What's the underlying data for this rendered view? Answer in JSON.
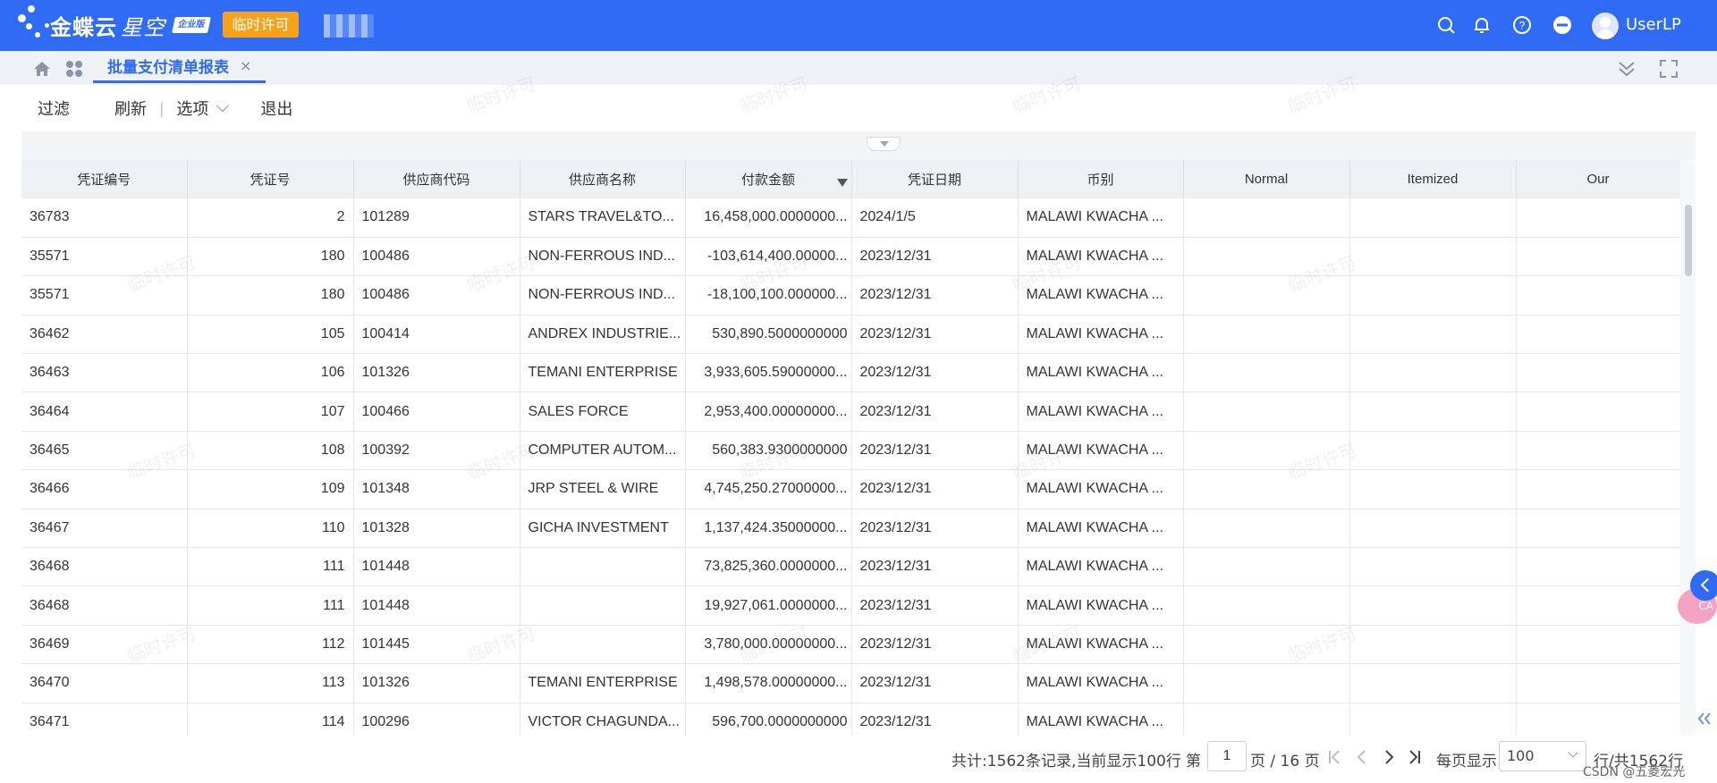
{
  "header": {
    "brand_main": "金蝶云",
    "brand_sub": "星空",
    "edition_badge": "企业版",
    "license_button": "临时许可",
    "user_name": "UserLP",
    "colors": {
      "bar": "#2f6bf5",
      "license": "#f7a21b"
    }
  },
  "tabs": [
    {
      "label": "批量支付清单报表",
      "close": "×",
      "active": true
    }
  ],
  "toolbar": {
    "filter": "过滤",
    "refresh": "刷新",
    "separator": "|",
    "options": "选项",
    "exit": "退出"
  },
  "table": {
    "columns": [
      "凭证编号",
      "凭证号",
      "供应商代码",
      "供应商名称",
      "付款金额",
      "凭证日期",
      "币别",
      "Normal",
      "Itemized",
      "Our"
    ],
    "rows": [
      [
        "36783",
        "2",
        "101289",
        "STARS TRAVEL&TO...",
        "16,458,000.0000000...",
        "2024/1/5",
        "MALAWI KWACHA ...",
        "",
        "",
        ""
      ],
      [
        "35571",
        "180",
        "100486",
        "NON-FERROUS IND...",
        "-103,614,400.00000...",
        "2023/12/31",
        "MALAWI KWACHA ...",
        "",
        "",
        ""
      ],
      [
        "35571",
        "180",
        "100486",
        "NON-FERROUS IND...",
        "-18,100,100.000000...",
        "2023/12/31",
        "MALAWI KWACHA ...",
        "",
        "",
        ""
      ],
      [
        "36462",
        "105",
        "100414",
        "ANDREX INDUSTRIE...",
        "530,890.5000000000",
        "2023/12/31",
        "MALAWI KWACHA ...",
        "",
        "",
        ""
      ],
      [
        "36463",
        "106",
        "101326",
        "TEMANI ENTERPRISE",
        "3,933,605.59000000...",
        "2023/12/31",
        "MALAWI KWACHA ...",
        "",
        "",
        ""
      ],
      [
        "36464",
        "107",
        "100466",
        "SALES FORCE",
        "2,953,400.00000000...",
        "2023/12/31",
        "MALAWI KWACHA ...",
        "",
        "",
        ""
      ],
      [
        "36465",
        "108",
        "100392",
        "COMPUTER AUTOM...",
        "560,383.9300000000",
        "2023/12/31",
        "MALAWI KWACHA ...",
        "",
        "",
        ""
      ],
      [
        "36466",
        "109",
        "101348",
        "JRP STEEL & WIRE",
        "4,745,250.27000000...",
        "2023/12/31",
        "MALAWI KWACHA ...",
        "",
        "",
        ""
      ],
      [
        "36467",
        "110",
        "101328",
        "GICHA INVESTMENT",
        "1,137,424.35000000...",
        "2023/12/31",
        "MALAWI KWACHA ...",
        "",
        "",
        ""
      ],
      [
        "36468",
        "111",
        "101448",
        "",
        "73,825,360.0000000...",
        "2023/12/31",
        "MALAWI KWACHA ...",
        "",
        "",
        ""
      ],
      [
        "36468",
        "111",
        "101448",
        "",
        "19,927,061.0000000...",
        "2023/12/31",
        "MALAWI KWACHA ...",
        "",
        "",
        ""
      ],
      [
        "36469",
        "112",
        "101445",
        "",
        "3,780,000.00000000...",
        "2023/12/31",
        "MALAWI KWACHA ...",
        "",
        "",
        ""
      ],
      [
        "36470",
        "113",
        "101326",
        "TEMANI ENTERPRISE",
        "1,498,578.00000000...",
        "2023/12/31",
        "MALAWI KWACHA ...",
        "",
        "",
        ""
      ],
      [
        "36471",
        "114",
        "100296",
        "VICTOR CHAGUNDA...",
        "596,700.0000000000",
        "2023/12/31",
        "MALAWI KWACHA ...",
        "",
        "",
        ""
      ]
    ]
  },
  "footer": {
    "summary": "共计:1562条记录,当前显示100行",
    "page_prefix": "第",
    "page_value": "1",
    "page_suffix": "页 / 16 页",
    "per_page_label": "每页显示",
    "per_page_value": "100",
    "total_label": "行/共1562行",
    "csdn": "CSDN @五菱宏光"
  },
  "side": {
    "pink_label": "CA"
  },
  "watermark": "临时许可"
}
